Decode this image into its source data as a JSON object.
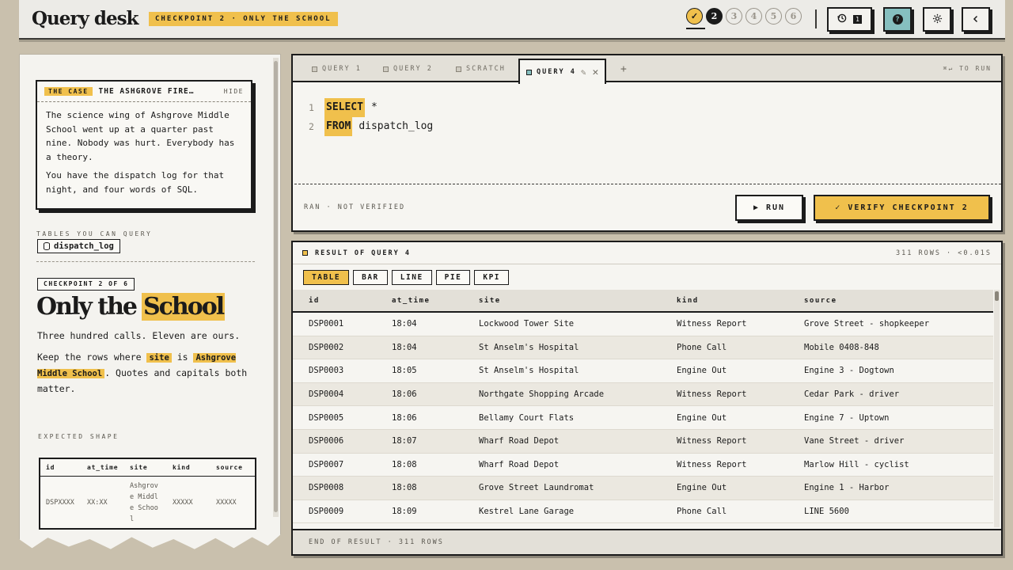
{
  "app": {
    "title": "Query desk",
    "checkpoint_pill": "CHECKPOINT 2 · ONLY THE SCHOOL"
  },
  "progress": {
    "steps": [
      {
        "label": "✓",
        "state": "done"
      },
      {
        "label": "2",
        "state": "active"
      },
      {
        "label": "3",
        "state": "locked"
      },
      {
        "label": "4",
        "state": "locked"
      },
      {
        "label": "5",
        "state": "locked"
      },
      {
        "label": "6",
        "state": "locked"
      }
    ]
  },
  "toolbar": {
    "history_count": "1",
    "help_label": "?",
    "history_icon": "history-icon",
    "settings_icon": "gear-icon",
    "collapse_icon": "chevron-left-icon"
  },
  "case": {
    "tag": "THE CASE",
    "title": "THE ASHGROVE FIRE…",
    "hide_label": "HIDE",
    "paragraph1": "The science wing of Ashgrove Middle School went up at a quarter past nine. Nobody was hurt. Everybody has a theory.",
    "paragraph2": "You have the dispatch log for that night, and four words of SQL."
  },
  "tables": {
    "label": "TABLES YOU CAN QUERY",
    "items": [
      "dispatch_log"
    ]
  },
  "checkpoint": {
    "badge": "CHECKPOINT 2 OF 6",
    "title_plain": "Only the",
    "title_highlight": "School",
    "intro": "Three hundred calls. Eleven are ours.",
    "instr_a": "Keep the rows where ",
    "instr_code1": "site",
    "instr_b": " is ",
    "instr_code2": "Ashgrove Middle School",
    "instr_c": ". Quotes and capitals both matter."
  },
  "expected": {
    "label": "EXPECTED SHAPE",
    "columns": [
      "id",
      "at_time",
      "site",
      "kind",
      "source"
    ],
    "row": [
      "DSPXXXX",
      "XX:XX",
      "Ashgrove Middle School",
      "XXXXX",
      "XXXXX"
    ]
  },
  "editor": {
    "tabs": [
      {
        "label": "QUERY 1",
        "active": false
      },
      {
        "label": "QUERY 2",
        "active": false
      },
      {
        "label": "SCRATCH",
        "active": false
      },
      {
        "label": "QUERY 4",
        "active": true
      }
    ],
    "add_tab": "+",
    "run_hint": "⌘↵ TO RUN",
    "lines": [
      {
        "num": "1",
        "keyword": "SELECT",
        "rest": "*"
      },
      {
        "num": "2",
        "keyword": "FROM",
        "rest": "dispatch_log"
      }
    ],
    "status": "RAN · NOT VERIFIED",
    "run_label": "▶ RUN",
    "verify_label": "✓ VERIFY CHECKPOINT 2"
  },
  "results": {
    "title": "RESULT OF QUERY 4",
    "meta": "311 ROWS · <0.01S",
    "views": [
      {
        "label": "TABLE",
        "active": true
      },
      {
        "label": "BAR",
        "active": false
      },
      {
        "label": "LINE",
        "active": false
      },
      {
        "label": "PIE",
        "active": false
      },
      {
        "label": "KPI",
        "active": false
      }
    ],
    "columns": [
      "id",
      "at_time",
      "site",
      "kind",
      "source"
    ],
    "rows": [
      [
        "DSP0001",
        "18:04",
        "Lockwood Tower Site",
        "Witness Report",
        "Grove Street - shopkeeper"
      ],
      [
        "DSP0002",
        "18:04",
        "St Anselm's Hospital",
        "Phone Call",
        "Mobile 0408-848"
      ],
      [
        "DSP0003",
        "18:05",
        "St Anselm's Hospital",
        "Engine Out",
        "Engine 3 - Dogtown"
      ],
      [
        "DSP0004",
        "18:06",
        "Northgate Shopping Arcade",
        "Witness Report",
        "Cedar Park - driver"
      ],
      [
        "DSP0005",
        "18:06",
        "Bellamy Court Flats",
        "Engine Out",
        "Engine 7 - Uptown"
      ],
      [
        "DSP0006",
        "18:07",
        "Wharf Road Depot",
        "Witness Report",
        "Vane Street - driver"
      ],
      [
        "DSP0007",
        "18:08",
        "Wharf Road Depot",
        "Witness Report",
        "Marlow Hill - cyclist"
      ],
      [
        "DSP0008",
        "18:08",
        "Grove Street Laundromat",
        "Engine Out",
        "Engine 1 - Harbor"
      ],
      [
        "DSP0009",
        "18:09",
        "Kestrel Lane Garage",
        "Phone Call",
        "LINE 5600"
      ]
    ],
    "footer": "END OF RESULT · 311 ROWS"
  },
  "colors": {
    "accent": "#f0c04c",
    "teal": "#86bfbf",
    "ink": "#1b1b1b",
    "paper": "#f6f5f1",
    "desk": "#c9c0ad"
  }
}
